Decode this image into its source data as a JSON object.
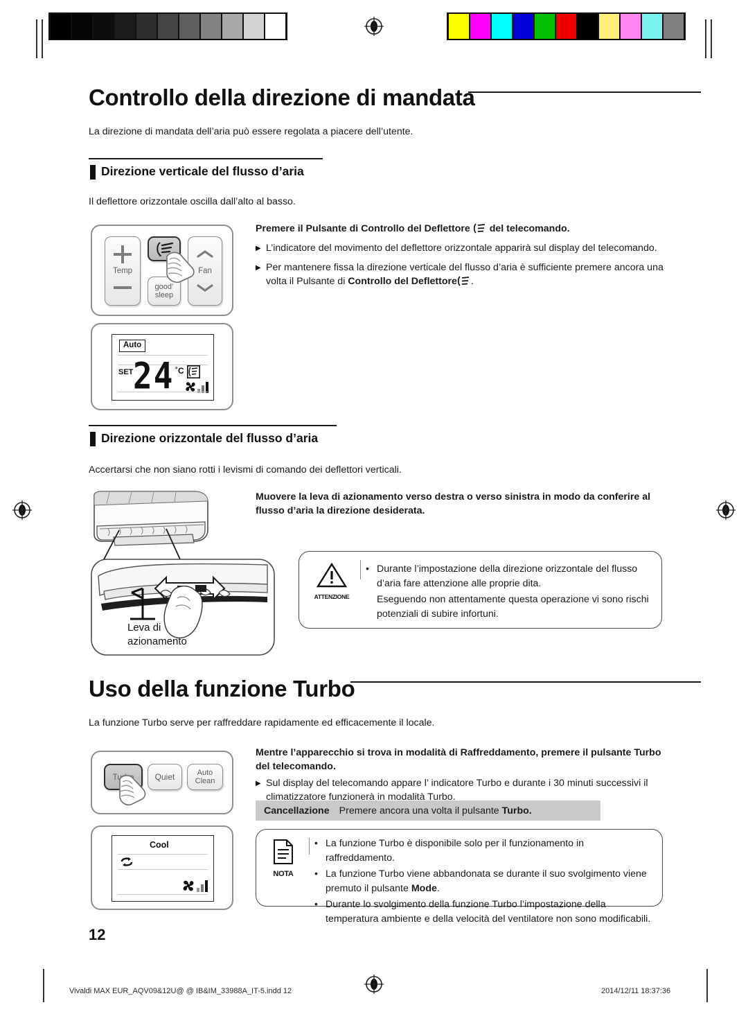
{
  "document": {
    "page_number": "12",
    "language": "it"
  },
  "calibration": {
    "grayscale": [
      "#000000",
      "#050505",
      "#0d0d0d",
      "#1c1c1c",
      "#2e2e2e",
      "#454545",
      "#5e5e5e",
      "#838383",
      "#a8a8a8",
      "#d2d2d2",
      "#ffffff"
    ],
    "color": [
      "#ffff00",
      "#ff00ff",
      "#00ffff",
      "#0000d8",
      "#00c000",
      "#ee0000",
      "#000000",
      "#ffef7a",
      "#ff86ef",
      "#7af3f3",
      "#808080"
    ]
  },
  "sections": {
    "airflow": {
      "title": "Controllo della direzione di mandata",
      "intro": "La direzione di mandata dell’aria può essere regolata a piacere dell’utente.",
      "vertical": {
        "subhead": "Direzione verticale del flusso d’aria",
        "intro": "Il deflettore orizzontale oscilla dall’alto al basso.",
        "instruction_pre": "Premere il Pulsante di Controllo del Deflettore",
        "instruction_post": "del telecomando.",
        "bullets": [
          {
            "marker": "▶",
            "text": "L’indicatore del movimento del deflettore orizzontale apparirà sul display del telecomando."
          },
          {
            "marker": "▶",
            "text_pre": "Per mantenere fissa la direzione verticale  del flusso d’aria è sufficiente premere ancora una volta il Pulsante di ",
            "bold": "Controllo del Deflettore",
            "text_post": "."
          }
        ],
        "remote_keys": {
          "temp_label": "Temp",
          "fan_label": "Fan",
          "goodsleep_line1": "good’",
          "goodsleep_line2": "sleep"
        },
        "lcd": {
          "mode": "Auto",
          "set_label": "SET",
          "temperature": "24",
          "unit": "˚C"
        }
      },
      "horizontal": {
        "subhead": "Direzione orizzontale del flusso d’aria",
        "intro": "Accertarsi che non siano rotti i levismi di comando dei deflettori verticali.",
        "instruction": "Muovere la leva di azionamento  verso destra o verso sinistra in modo da conferire al flusso d’aria la direzione desiderata.",
        "lever_label_line1": "Leva di",
        "lever_label_line2": "azionamento",
        "caution": {
          "icon_caption": "ATTENZIONE",
          "items": [
            {
              "marker": "•",
              "text": "Durante l’impostazione della direzione orizzontale del flusso d’aria fare attenzione alle proprie  dita."
            },
            {
              "marker": "",
              "text": "Eseguendo non attentamente questa operazione vi sono rischi potenziali di subire infortuni."
            }
          ]
        }
      }
    },
    "turbo": {
      "title": "Uso  della funzione Turbo",
      "intro": "La funzione Turbo serve per raffreddare rapidamente ed efficacemente  il locale.",
      "instruction": "Mentre l’apparecchio  si trova in modalità di Raffreddamento, premere il pulsante Turbo del telecomando.",
      "bullets": [
        {
          "marker": "▶",
          "text": "Sul display del telecomando appare l’ indicatore Turbo e durante i 30 minuti successivi  il climatizzatore funzionerà in modalità Turbo."
        }
      ],
      "cancellation": {
        "label": "Cancellazione",
        "text_pre": "Premere ancora una volta il pulsante ",
        "bold": "Turbo."
      },
      "remote_keys": {
        "turbo": "Turbo",
        "quiet": "Quiet",
        "autoclean_line1": "Auto",
        "autoclean_line2": "Clean"
      },
      "lcd": {
        "mode": "Cool"
      },
      "note": {
        "icon_caption": "NOTA",
        "items": [
          {
            "marker": "•",
            "text": "La funzione Turbo è disponibile solo per il funzionamento in raffreddamento."
          },
          {
            "marker": "•",
            "text_pre": "La funzione Turbo viene abbandonata se durante il suo svolgimento viene premuto il pulsante ",
            "bold": "Mode",
            "text_post": "."
          },
          {
            "marker": "•",
            "text": "Durante lo svolgimento della funzione Turbo l’impostazione della temperatura ambiente e della velocità del ventilatore non sono modificabili."
          }
        ]
      }
    }
  },
  "footer": {
    "filename": "Vivaldi MAX EUR_AQV09&12U@ @  IB&IM_33988A_IT-5.indd   12",
    "timestamp": "2014/12/11   18:37:36"
  }
}
